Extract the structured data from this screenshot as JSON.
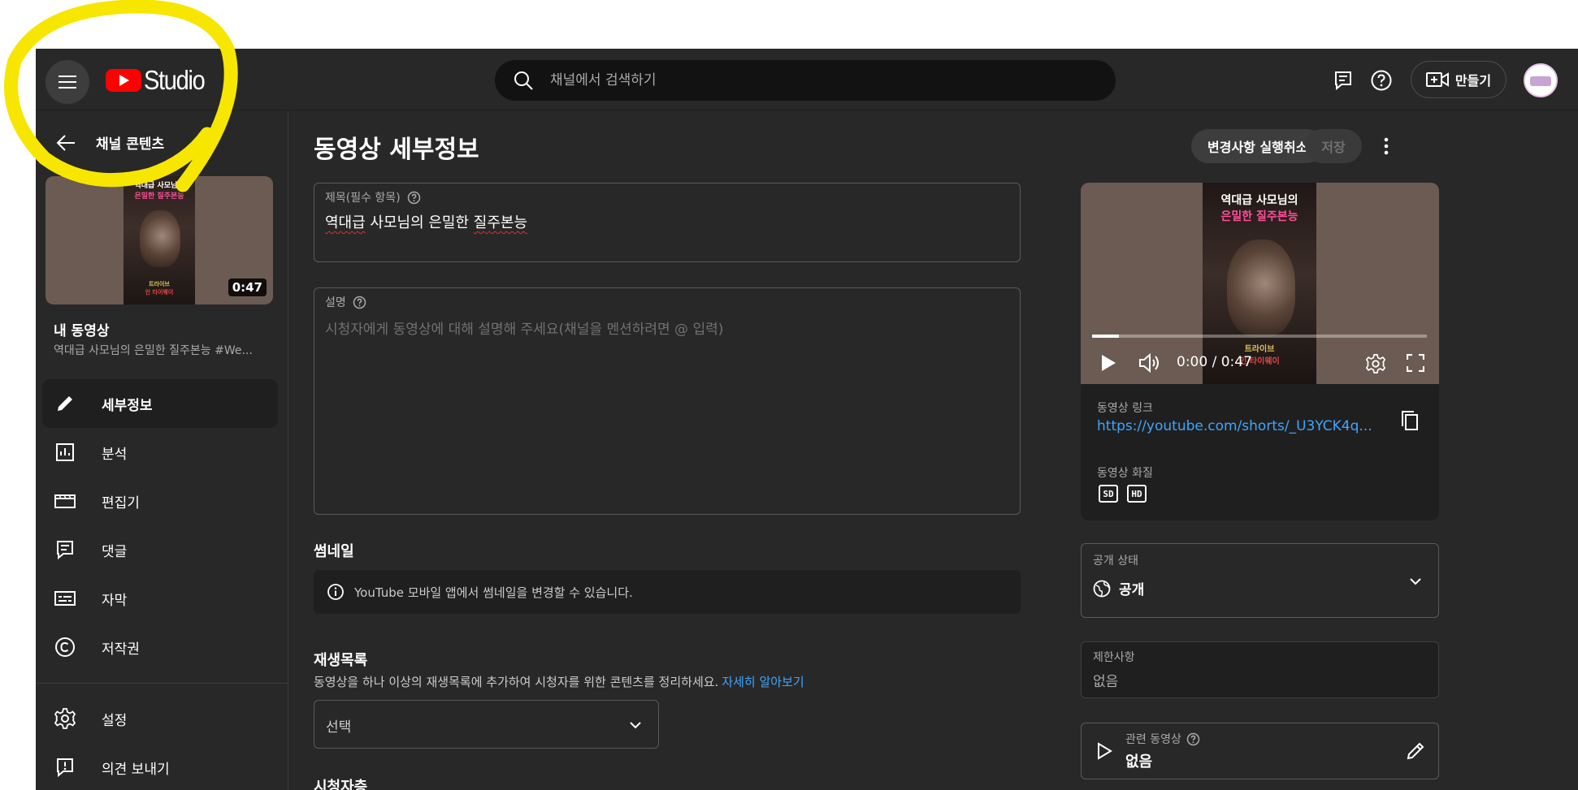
{
  "header": {
    "logo_text": "Studio",
    "search_placeholder": "채널에서 검색하기",
    "create_label": "만들기",
    "icons": [
      "menu-icon",
      "youtube-logo-icon",
      "search-icon",
      "feedback-icon",
      "help-icon",
      "create-video-icon",
      "avatar"
    ]
  },
  "sidebar": {
    "back_label": "채널 콘텐츠",
    "thumb_duration": "0:47",
    "poster_line1": "역대급 사모님의",
    "poster_line2": "은밀한 질주본능",
    "poster_foot1": "트라이브",
    "poster_foot2": "인 타이웨이",
    "my_video_label": "내 동영상",
    "video_title": "역대급 사모님의 은밀한 질주본능 #We...",
    "nav": [
      {
        "label": "세부정보",
        "icon": "pencil-icon",
        "active": true
      },
      {
        "label": "분석",
        "icon": "analytics-icon"
      },
      {
        "label": "편집기",
        "icon": "editor-icon"
      },
      {
        "label": "댓글",
        "icon": "comments-icon"
      },
      {
        "label": "자막",
        "icon": "subtitles-icon"
      },
      {
        "label": "저작권",
        "icon": "copyright-icon"
      }
    ],
    "nav_bottom": [
      {
        "label": "설정",
        "icon": "settings-icon"
      },
      {
        "label": "의견 보내기",
        "icon": "feedback-icon"
      }
    ]
  },
  "main": {
    "page_title": "동영상 세부정보",
    "undo_label": "변경사항 실행취소",
    "save_label": "저장",
    "title_field": {
      "label": "제목(필수 항목)",
      "value_part1": "역대급",
      "value_part2": " 사모님의 은밀한 ",
      "value_part3": "질주본능"
    },
    "description_field": {
      "label": "설명",
      "placeholder": "시청자에게 동영상에 대해 설명해 주세요(채널을 멘션하려면 @ 입력)"
    },
    "thumbnail": {
      "title": "썸네일",
      "info": "YouTube 모바일 앱에서 썸네일을 변경할 수 있습니다."
    },
    "playlist": {
      "title": "재생목록",
      "description": "동영상을 하나 이상의 재생목록에 추가하여 시청자를 위한 콘텐츠를 정리하세요.",
      "learn_more": "자세히 알아보기",
      "select_label": "선택"
    },
    "audience_title": "시청자층"
  },
  "preview": {
    "time": "0:00 / 0:47",
    "progress_fraction": 0.08,
    "link_label": "동영상 링크",
    "link_value": "https://youtube.com/shorts/_U3YCK4q...",
    "quality_label": "동영상 화질",
    "quality_badges": [
      "SD",
      "HD"
    ]
  },
  "visibility": {
    "label": "공개 상태",
    "value": "공개"
  },
  "restrictions": {
    "label": "제한사항",
    "value": "없음"
  },
  "related": {
    "label": "관련 동영상",
    "value": "없음"
  },
  "colors": {
    "background": "#282828",
    "accent_link": "#3ea6ff",
    "brand_red": "#ff0000",
    "annotation_yellow": "#f7e600"
  }
}
